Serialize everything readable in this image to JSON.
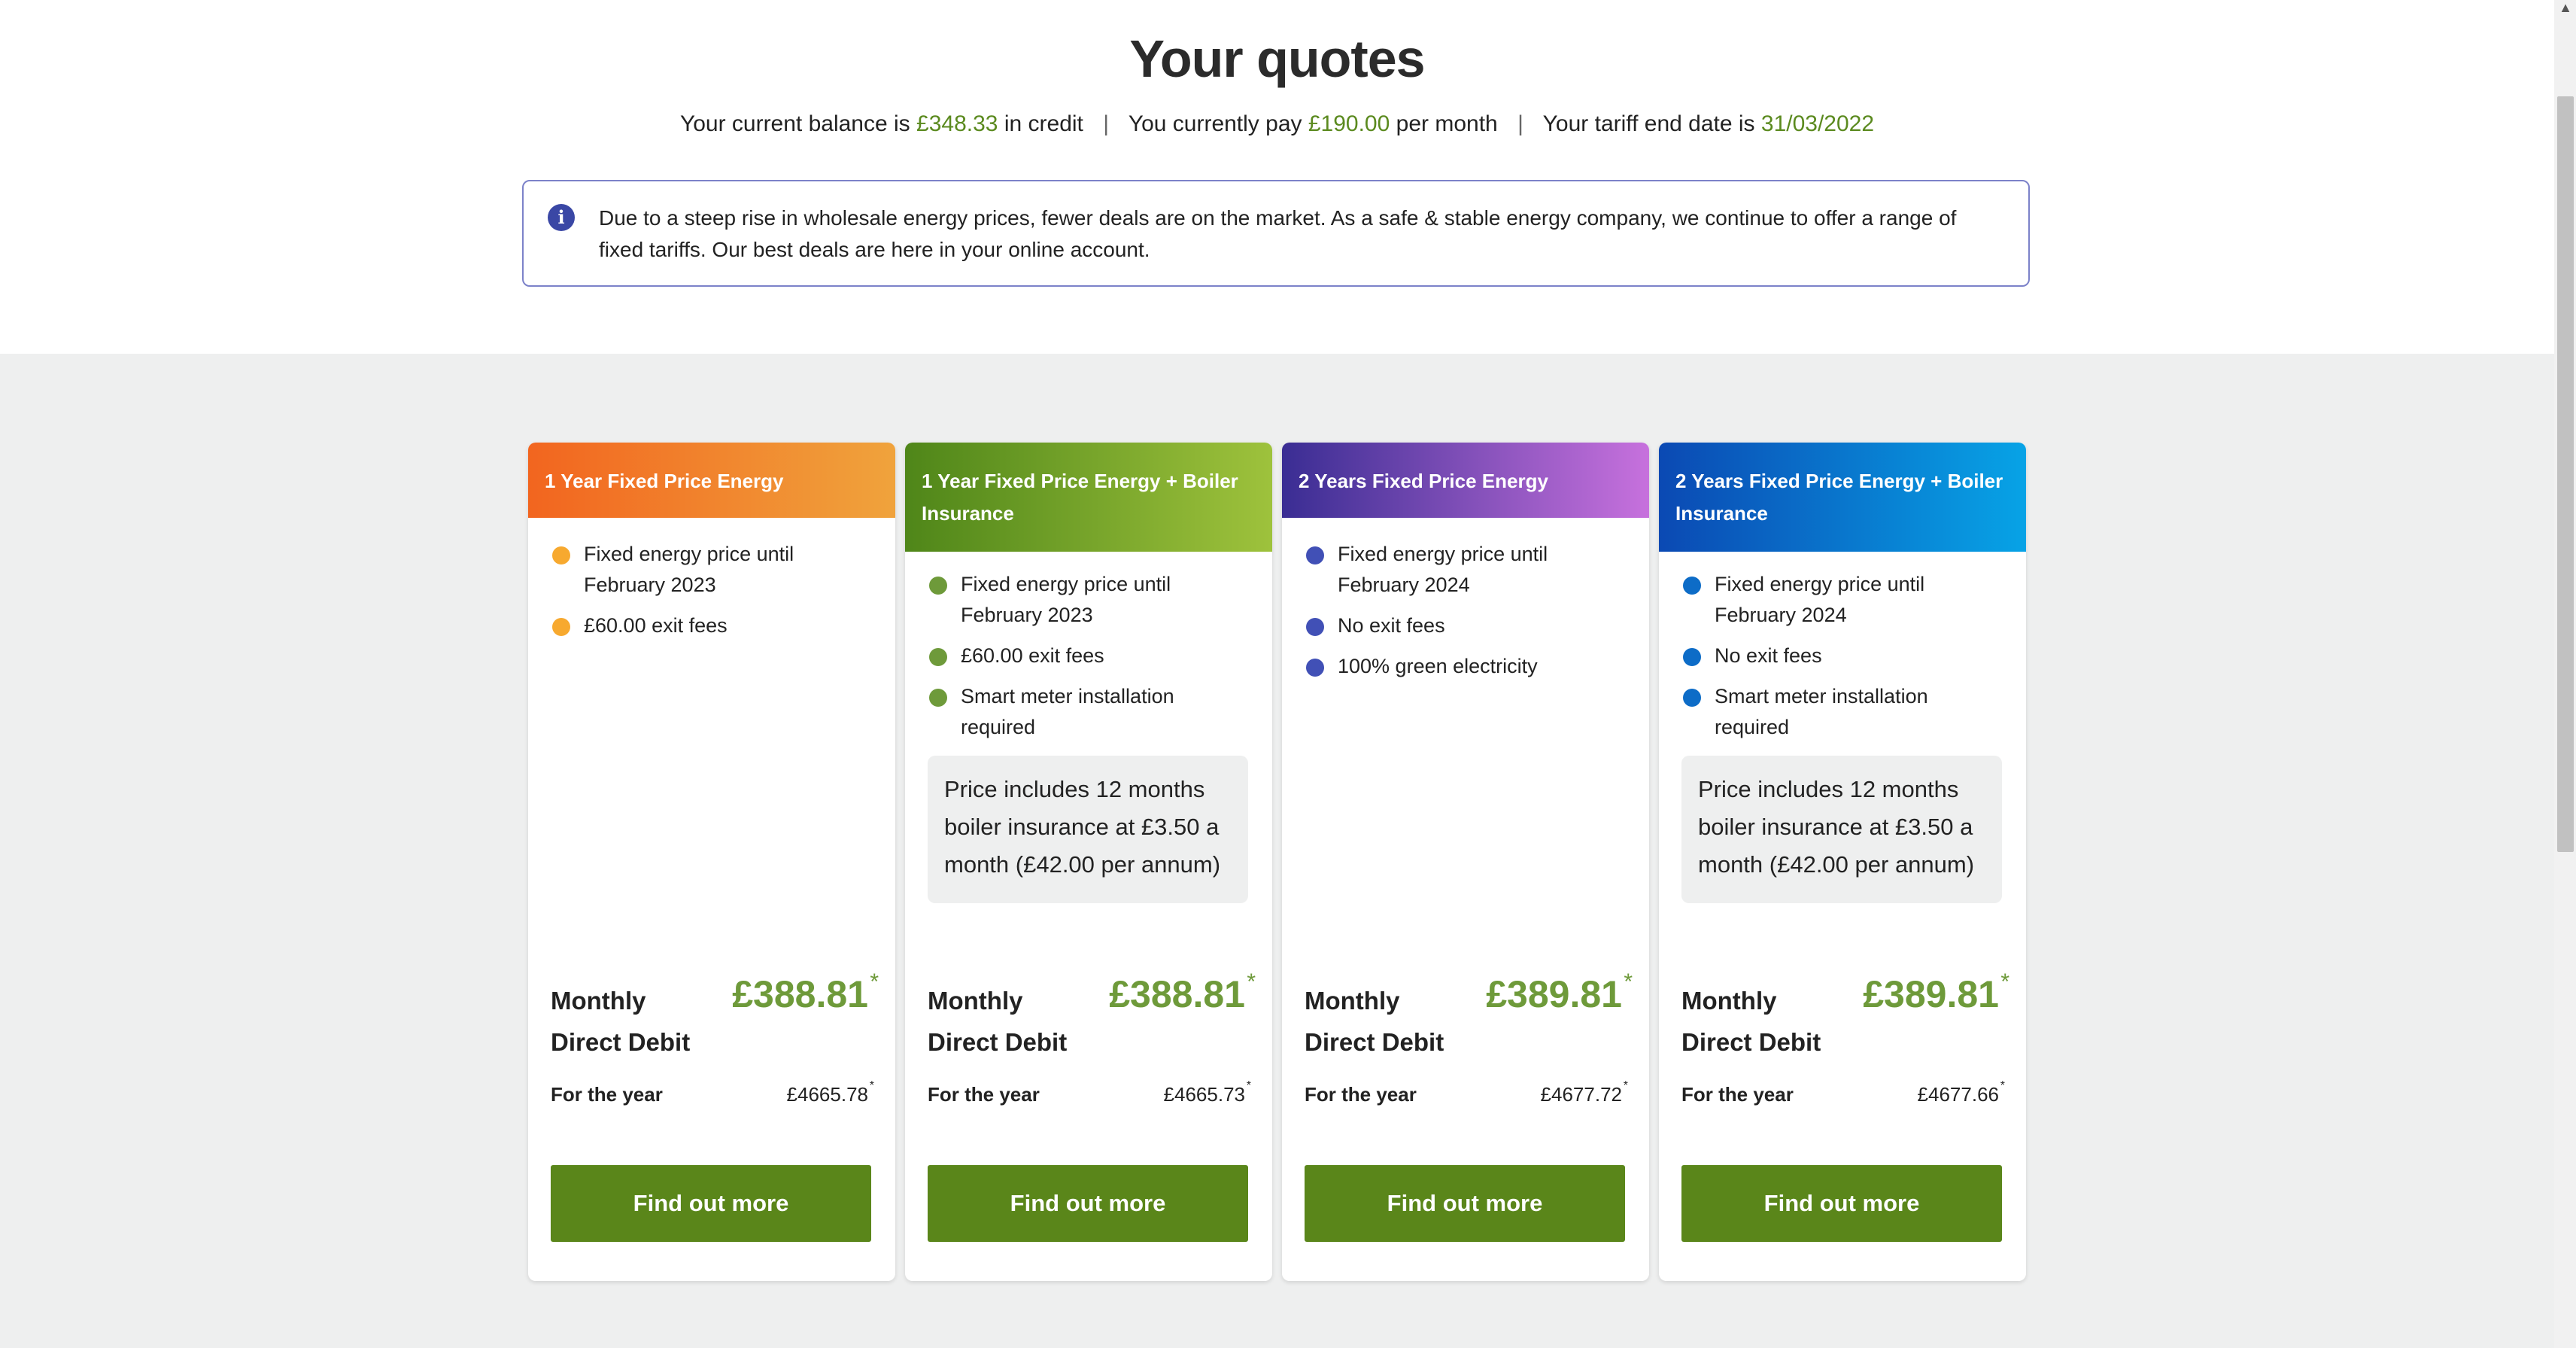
{
  "page": {
    "title": "Your quotes"
  },
  "summary": {
    "balance_prefix": "Your current balance is",
    "balance_value": "£348.33",
    "balance_suffix": "in credit",
    "pay_prefix": "You currently pay",
    "pay_value": "£190.00",
    "pay_suffix": "per month",
    "tariff_prefix": "Your tariff end date is",
    "tariff_value": "31/03/2022",
    "separator": "|"
  },
  "notice": {
    "icon": "info-icon",
    "icon_glyph": "i",
    "text": "Due to a steep rise in wholesale energy prices, fewer deals are on the market. As a safe & stable energy company, we continue to offer a range of fixed tariffs. Our best deals are here in your online account."
  },
  "quotes": [
    {
      "title": "1 Year Fixed Price Energy",
      "features": [
        "Fixed energy price until February 2023",
        "£60.00 exit fees"
      ],
      "note": "",
      "monthly_label": "Monthly Direct Debit",
      "monthly_price": "£388.81",
      "price_star": "*",
      "year_label": "For the year",
      "year_price": "£4665.78",
      "year_star": "*",
      "cta": "Find out more"
    },
    {
      "title": "1 Year Fixed Price Energy + Boiler Insurance",
      "features": [
        "Fixed energy price until February 2023",
        "£60.00 exit fees",
        "Smart meter installation required"
      ],
      "note": "Price includes 12 months boiler insurance at £3.50 a month (£42.00 per annum)",
      "monthly_label": "Monthly Direct Debit",
      "monthly_price": "£388.81",
      "price_star": "*",
      "year_label": "For the year",
      "year_price": "£4665.73",
      "year_star": "*",
      "cta": "Find out more"
    },
    {
      "title": "2 Years Fixed Price Energy",
      "features": [
        "Fixed energy price until February 2024",
        "No exit fees",
        "100% green electricity"
      ],
      "note": "",
      "monthly_label": "Monthly Direct Debit",
      "monthly_price": "£389.81",
      "price_star": "*",
      "year_label": "For the year",
      "year_price": "£4677.72",
      "year_star": "*",
      "cta": "Find out more"
    },
    {
      "title": "2 Years Fixed Price Energy + Boiler Insurance",
      "features": [
        "Fixed energy price until February 2024",
        "No exit fees",
        "Smart meter installation required"
      ],
      "note": "Price includes 12 months boiler insurance at £3.50 a month (£42.00 per annum)",
      "monthly_label": "Monthly Direct Debit",
      "monthly_price": "£389.81",
      "price_star": "*",
      "year_label": "For the year",
      "year_price": "£4677.66",
      "year_star": "*",
      "cta": "Find out more"
    }
  ],
  "colors": {
    "accent_green": "#6e9a3a",
    "button_green": "#5a861a",
    "info_blue": "#3a47a5"
  },
  "scrollbar": {
    "up_arrow": "▲"
  }
}
